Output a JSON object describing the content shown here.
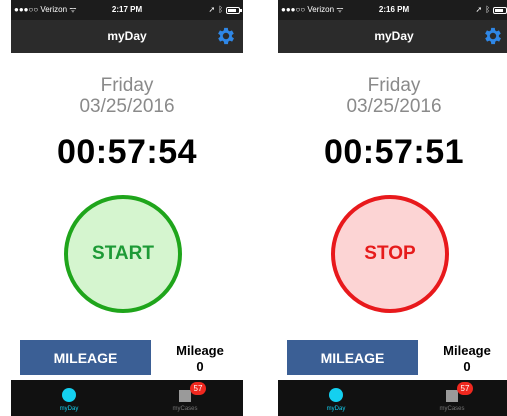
{
  "screens": [
    {
      "status": {
        "carrier": "●●●○○ Verizon ᯤ",
        "time": "2:17 PM"
      },
      "nav": {
        "title": "myDay",
        "settings_icon": "gear-icon"
      },
      "day": "Friday",
      "date": "03/25/2016",
      "timer": "00:57:54",
      "action": {
        "label": "START",
        "state": "start"
      },
      "mileage": {
        "button_label": "MILEAGE",
        "label": "Mileage",
        "value": "0"
      },
      "tabs": [
        {
          "label": "myDay",
          "icon": "circle-icon",
          "active": true
        },
        {
          "label": "myCases",
          "icon": "square-icon",
          "active": false,
          "badge": "57"
        }
      ]
    },
    {
      "status": {
        "carrier": "●●●○○ Verizon ᯤ",
        "time": "2:16 PM"
      },
      "nav": {
        "title": "myDay",
        "settings_icon": "gear-icon"
      },
      "day": "Friday",
      "date": "03/25/2016",
      "timer": "00:57:51",
      "action": {
        "label": "STOP",
        "state": "stop"
      },
      "mileage": {
        "button_label": "MILEAGE",
        "label": "Mileage",
        "value": "0"
      },
      "tabs": [
        {
          "label": "myDay",
          "icon": "circle-icon",
          "active": true
        },
        {
          "label": "myCases",
          "icon": "square-icon",
          "active": false,
          "badge": "57"
        }
      ]
    }
  ],
  "colors": {
    "start_fill": "#d5f5cf",
    "start_border": "#1fa51b",
    "stop_fill": "#fcd4d4",
    "stop_border": "#e8191c",
    "mileage_button": "#3b5f95",
    "tab_active": "#14d0f0",
    "settings_icon": "#2f87e6"
  }
}
